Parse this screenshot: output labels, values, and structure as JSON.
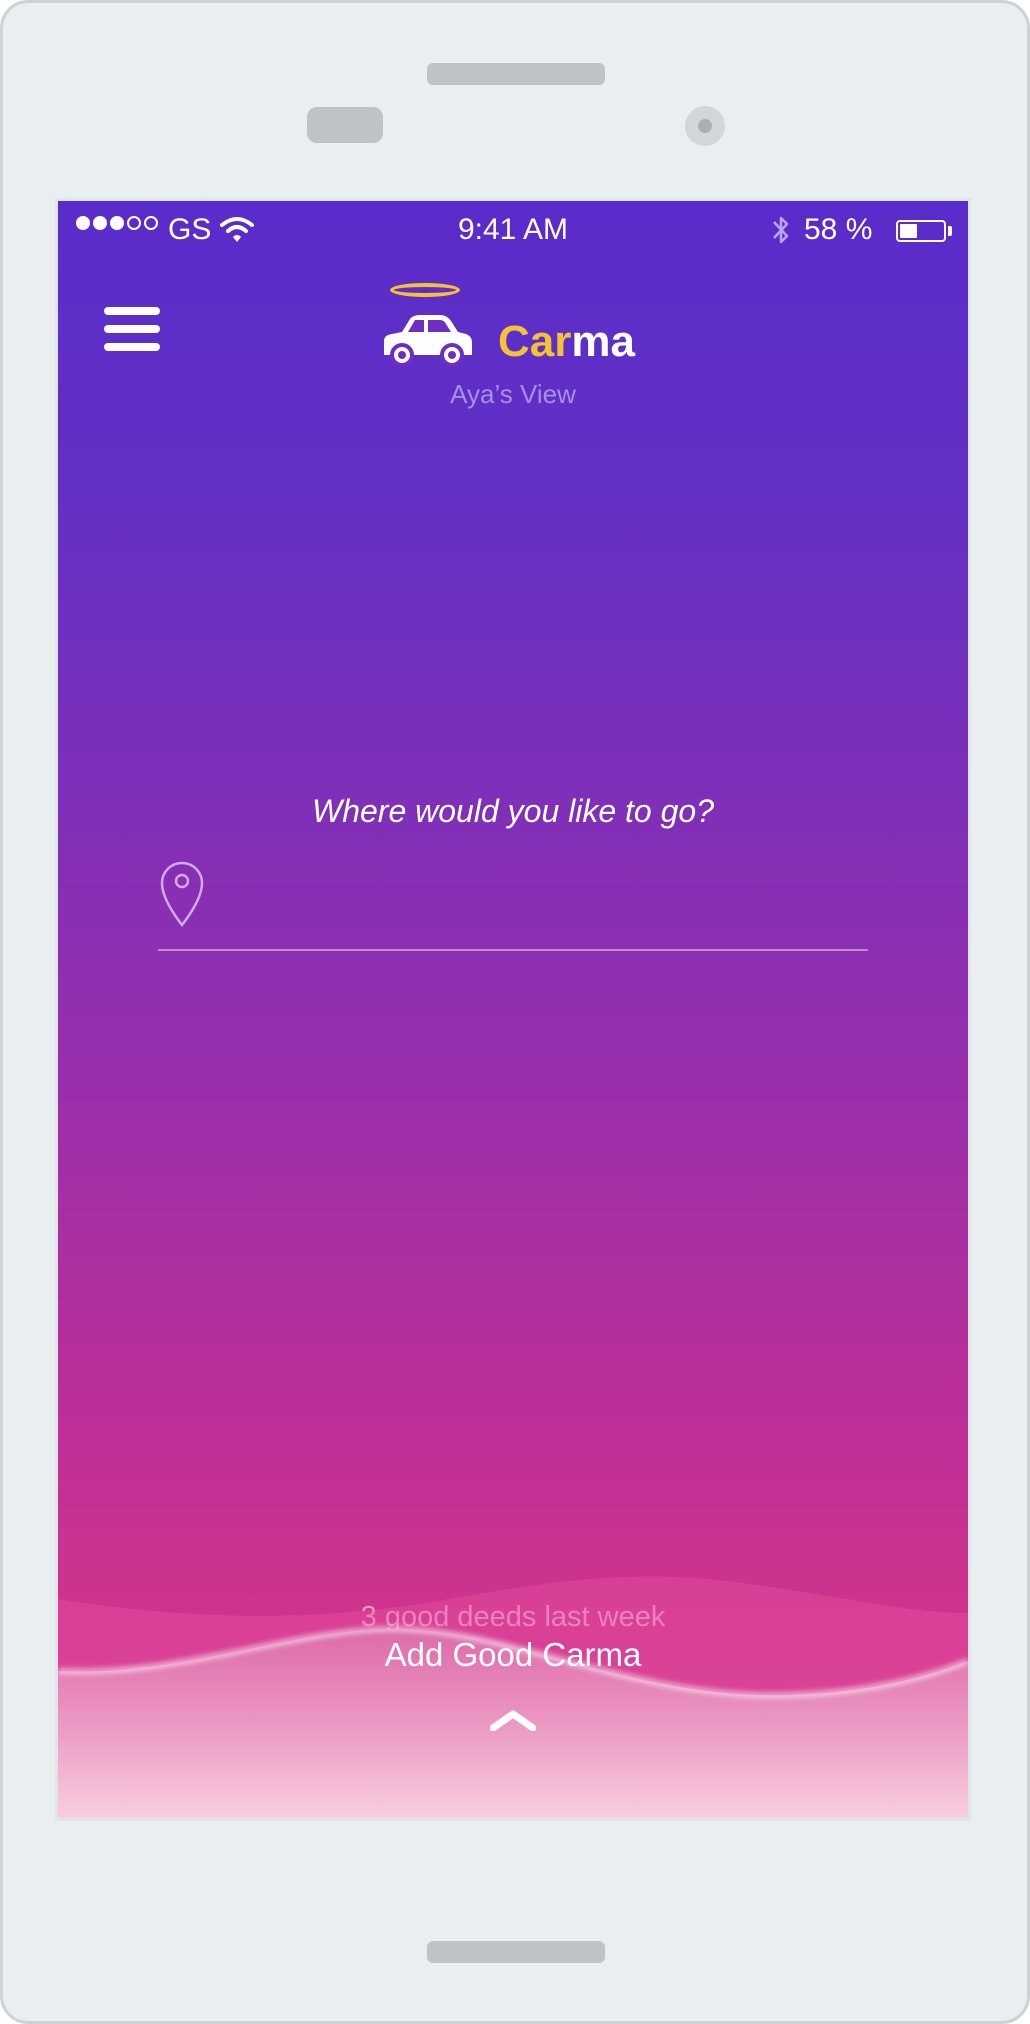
{
  "status_bar": {
    "carrier": "GS",
    "signal_bars_filled": 3,
    "signal_bars_total": 5,
    "time": "9:41 AM",
    "battery_percent_text": "58 %",
    "battery_level": 0.58,
    "icons": [
      "wifi-icon",
      "bluetooth-icon",
      "battery-icon"
    ]
  },
  "header": {
    "menu_icon": "hamburger-menu-icon",
    "logo_icon": "car-with-halo-icon",
    "brand_part1": "Car",
    "brand_part2": "ma",
    "subtitle": "Aya’s View"
  },
  "main": {
    "prompt": "Where would you like to go?",
    "destination_icon": "location-pin-icon",
    "destination_value": "",
    "deeds_text": "3 good deeds last week"
  },
  "bottom_panel": {
    "action_label": "Add Good Carma",
    "action_icon": "chevron-up-icon"
  },
  "colors": {
    "gradient_top": "#5a2ccb",
    "gradient_bottom": "#d63c8f",
    "brand_accent": "#f3c331",
    "panel_light": "#f7c7dc"
  }
}
